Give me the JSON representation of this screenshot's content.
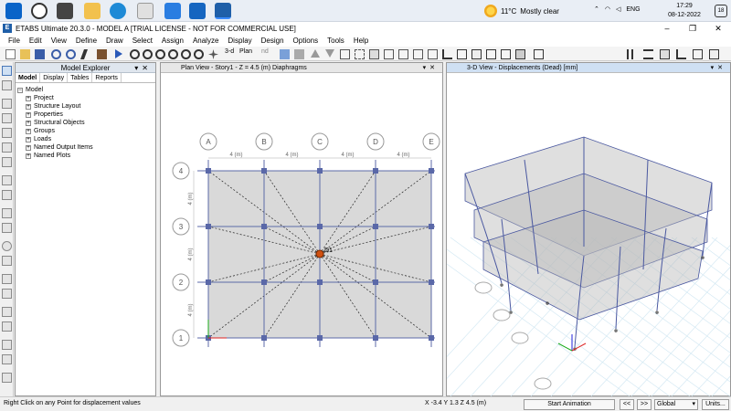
{
  "taskbar": {
    "weather_temp": "11°C",
    "weather_text": "Mostly clear",
    "language": "ENG",
    "time": "17:29",
    "date": "08-12-2022",
    "notifications": "18"
  },
  "window": {
    "title": "ETABS Ultimate 20.3.0 - MODEL A  [TRIAL LICENSE - NOT FOR COMMERCIAL USE]",
    "logo_letter": "E"
  },
  "menu": [
    "File",
    "Edit",
    "View",
    "Define",
    "Draw",
    "Select",
    "Assign",
    "Analyze",
    "Display",
    "Design",
    "Options",
    "Tools",
    "Help"
  ],
  "toolbar": {
    "label_3d": "3-d",
    "label_plan": "Plan",
    "label_nd": "nd"
  },
  "explorer": {
    "title": "Model Explorer",
    "tabs": [
      "Model",
      "Display",
      "Tables",
      "Reports"
    ],
    "root": "Model",
    "items": [
      "Project",
      "Structure Layout",
      "Properties",
      "Structural Objects",
      "Groups",
      "Loads",
      "Named Output Items",
      "Named Plots"
    ]
  },
  "plan_view": {
    "title": "Plan View - Story1 - Z = 4.5 (m)  Diaphragms",
    "column_grid": [
      "A",
      "B",
      "C",
      "D",
      "E"
    ],
    "row_grid": [
      "4",
      "3",
      "2",
      "1"
    ],
    "spacing_label": "4 (m)",
    "diaphragm_label": "D1"
  },
  "view3d": {
    "title": "3-D View  - Displacements (Dead)  [mm]"
  },
  "status": {
    "hint": "Right Click on any Point for displacement values",
    "coords": "X -3.4  Y 1.3  Z 4.5 (m)",
    "start_animation": "Start Animation",
    "prev": "<<",
    "next": ">>",
    "coord_system": "Global",
    "units": "Units..."
  },
  "colors": {
    "accent": "#1f5fa8",
    "grid_line": "#5c6aa8",
    "joint": "#5a68a8",
    "slab": "#d9d9d9",
    "diaphragm": "#d05010"
  }
}
